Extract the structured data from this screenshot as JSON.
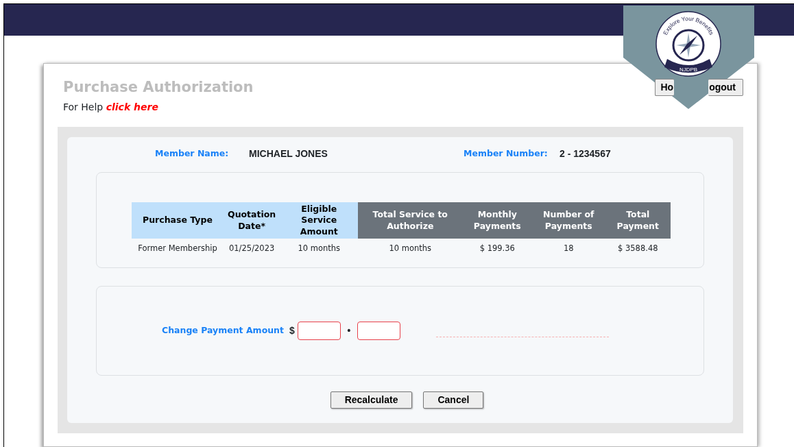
{
  "badge": {
    "motto": "Explore Your Benefits",
    "label": "NJDPB"
  },
  "header": {
    "title": "Purchase Authorization",
    "help_prefix": "For Help",
    "help_link": "click here"
  },
  "nav_buttons": [
    "Ho",
    "ogout"
  ],
  "member": {
    "name_label": "Member Name:",
    "name": "MICHAEL JONES",
    "number_label": "Member Number:",
    "number": "2 - 1234567"
  },
  "table": {
    "columns": [
      {
        "label": "Purchase Type",
        "color": "#bfe0fb"
      },
      {
        "label": "Quotation Date*",
        "color": "#bfe0fb"
      },
      {
        "label": "Eligible Service Amount",
        "color": "#bfe0fb"
      },
      {
        "label": "Total Service to Authorize",
        "color": "#6b737b"
      },
      {
        "label": "Monthly Payments",
        "color": "#6b737b"
      },
      {
        "label": "Number of Payments",
        "color": "#6b737b"
      },
      {
        "label": "Total Payment",
        "color": "#6b737b"
      }
    ],
    "rows": [
      [
        "Former Membership",
        "01/25/2023",
        "10 months",
        "10 months",
        "$  199.36",
        "18",
        "$ 3588.48"
      ]
    ]
  },
  "change_payment": {
    "label": "Change Payment Amount",
    "currency": "$",
    "separator": "•",
    "fields": [
      {
        "invalid": true
      },
      {
        "invalid": true
      }
    ]
  },
  "buttons": [
    "Recalculate",
    "Cancel"
  ]
}
